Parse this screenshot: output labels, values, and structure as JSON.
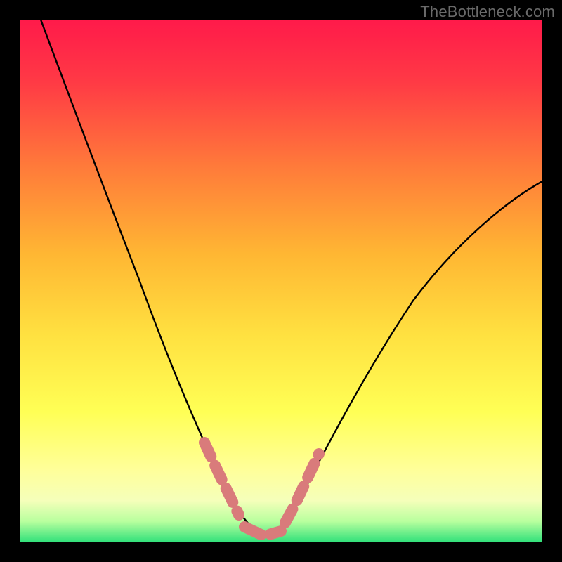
{
  "watermark": "TheBottleneck.com",
  "chart_data": {
    "type": "line",
    "title": "",
    "xlabel": "",
    "ylabel": "",
    "xlim": [
      0,
      100
    ],
    "ylim": [
      0,
      100
    ],
    "grid": false,
    "legend": false,
    "background_gradient": {
      "top_color": "#ff1a4a",
      "mid_colors": [
        "#ff7a3a",
        "#ffd633",
        "#ffff66",
        "#ffff99"
      ],
      "bottom_color": "#2fe07a"
    },
    "series": [
      {
        "name": "curve",
        "color": "#000000",
        "x": [
          4,
          8,
          12,
          16,
          20,
          24,
          28,
          32,
          34,
          36,
          38,
          40,
          42,
          44,
          46,
          48,
          52,
          56,
          60,
          64,
          68,
          72,
          76,
          80,
          84,
          88,
          92,
          96,
          100
        ],
        "y": [
          100,
          89,
          78,
          68,
          58,
          49,
          40,
          31,
          26,
          22,
          17,
          12,
          8,
          5,
          3,
          3,
          5,
          10,
          17,
          24,
          31,
          38,
          44,
          50,
          55,
          59,
          63,
          66,
          69
        ]
      }
    ],
    "trough_markers": {
      "color": "#d97b7b",
      "left_segment": {
        "x": [
          32,
          34,
          36,
          38,
          40
        ],
        "y": [
          31,
          26,
          22,
          17,
          12
        ]
      },
      "floor_segment": {
        "x": [
          40,
          44,
          48
        ],
        "y": [
          4,
          3,
          4
        ]
      },
      "right_segment": {
        "x": [
          48,
          50,
          52,
          54
        ],
        "y": [
          5,
          8,
          12,
          17
        ]
      }
    }
  }
}
